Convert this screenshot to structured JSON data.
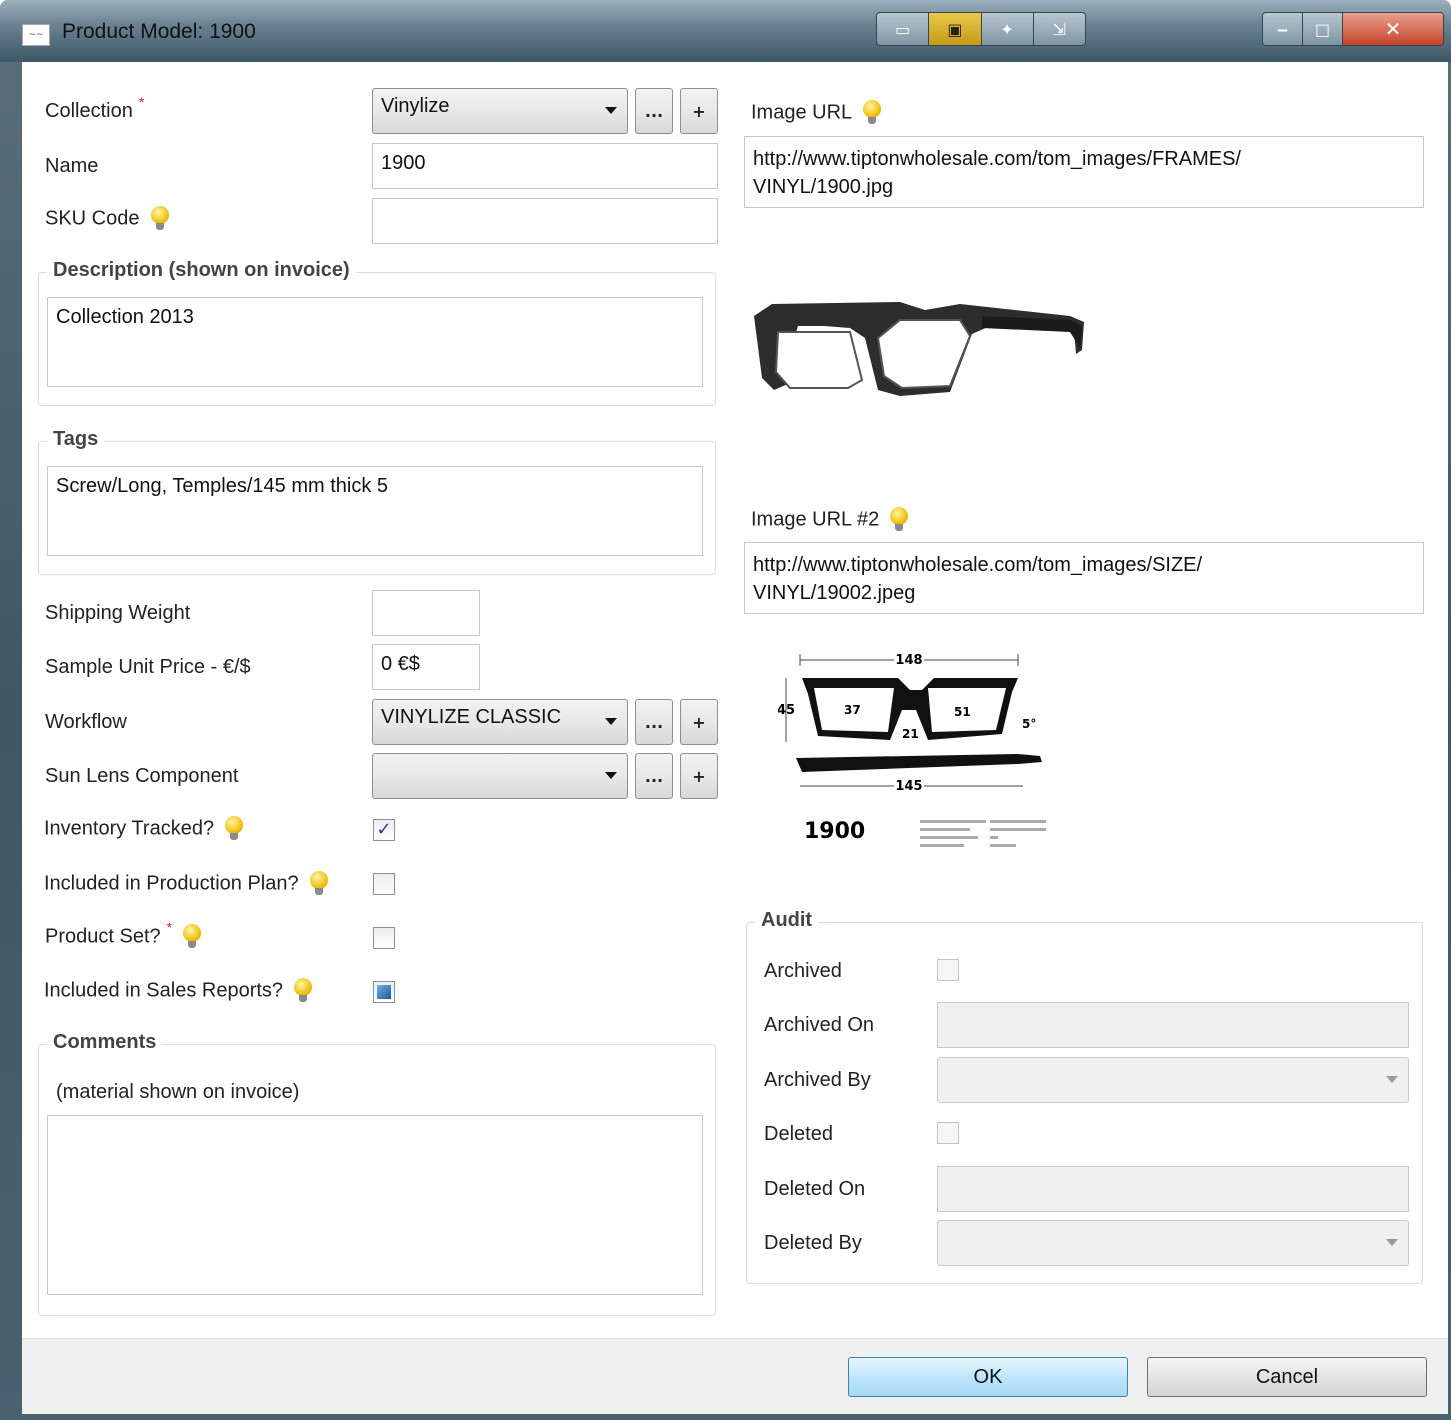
{
  "window": {
    "title": "Product Model: 1900",
    "app_icon": "app-logo-icon"
  },
  "toolbar_icons": [
    "dock-icon",
    "window-icon",
    "pin-icon",
    "resize-icon"
  ],
  "form": {
    "collection": {
      "label": "Collection",
      "value": "Vinylize",
      "required": "*",
      "browse": "...",
      "add": "+"
    },
    "name": {
      "label": "Name",
      "value": "1900"
    },
    "sku": {
      "label": "SKU Code",
      "value": ""
    },
    "description": {
      "title": "Description (shown on invoice)",
      "value": "Collection 2013"
    },
    "tags": {
      "title": "Tags",
      "value": "Screw/Long, Temples/145 mm thick 5"
    },
    "shipping_weight": {
      "label": "Shipping Weight",
      "value": ""
    },
    "sample_price": {
      "label": "Sample Unit Price - €/$",
      "value": "0 €$"
    },
    "workflow": {
      "label": "Workflow",
      "value": "VINYLIZE CLASSIC",
      "browse": "...",
      "add": "+"
    },
    "sun_lens": {
      "label": "Sun Lens Component",
      "value": "",
      "browse": "...",
      "add": "+"
    },
    "inventory_tracked": {
      "label": "Inventory Tracked?",
      "checked": true
    },
    "production_plan": {
      "label": "Included in Production Plan?",
      "checked": false
    },
    "product_set": {
      "label": "Product Set?",
      "required": "*",
      "checked": false
    },
    "sales_reports": {
      "label": "Included in Sales Reports?",
      "state": "indeterminate"
    },
    "comments": {
      "title": "Comments",
      "hint": "(material shown on invoice)",
      "value": ""
    }
  },
  "images": {
    "image_url": {
      "label": "Image URL",
      "value": "http://www.tiptonwholesale.com/tom_images/FRAMES/\nVINYL/1900.jpg"
    },
    "image_url2": {
      "label": "Image URL #2",
      "value": "http://www.tiptonwholesale.com/tom_images/SIZE/\nVINYL/19002.jpeg"
    },
    "diagram": {
      "model": "1900",
      "width": "148",
      "lens_left": "37",
      "lens_right": "51",
      "bridge": "21",
      "height": "45",
      "temple": "145",
      "angle": "5°"
    }
  },
  "audit": {
    "title": "Audit",
    "archived": {
      "label": "Archived"
    },
    "archived_on": {
      "label": "Archived On",
      "value": ""
    },
    "archived_by": {
      "label": "Archived By",
      "value": ""
    },
    "deleted": {
      "label": "Deleted"
    },
    "deleted_on": {
      "label": "Deleted On",
      "value": ""
    },
    "deleted_by": {
      "label": "Deleted By",
      "value": ""
    }
  },
  "buttons": {
    "ok": "OK",
    "cancel": "Cancel"
  },
  "colors": {
    "accent": "#3c7fb1",
    "required": "#dd2222",
    "bulb": "#f2c10c"
  }
}
